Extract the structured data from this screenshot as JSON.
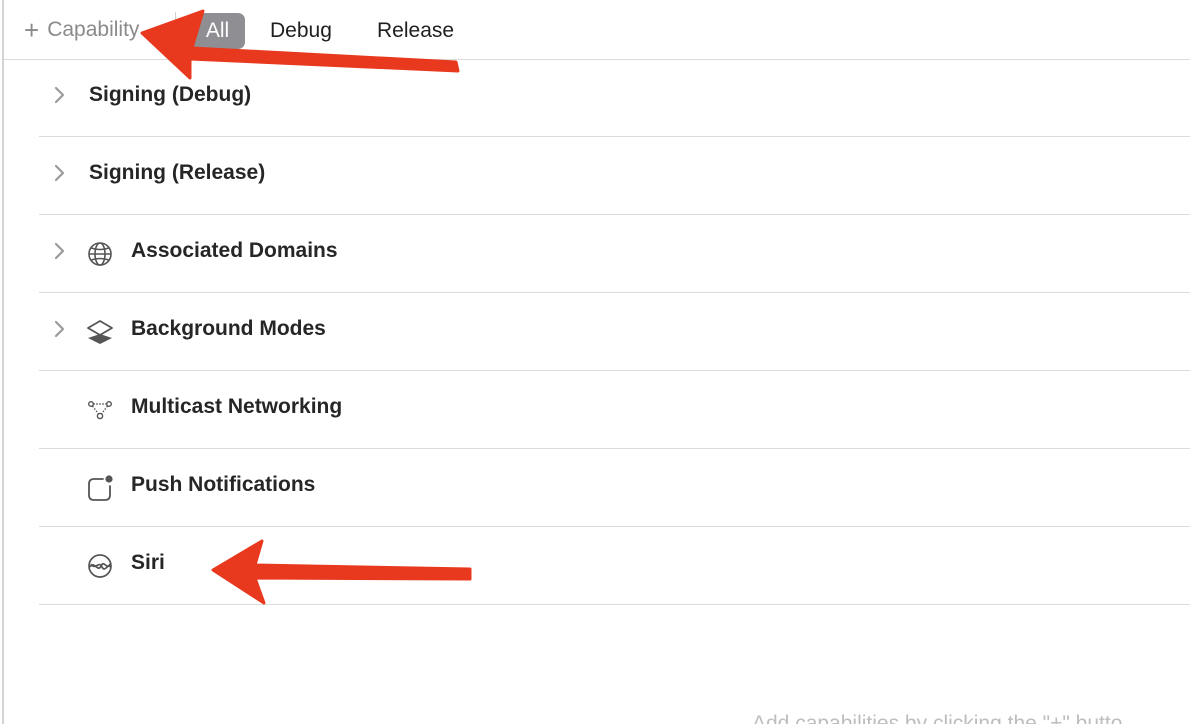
{
  "toolbar": {
    "add_label": "Capability",
    "add_icon": "plus-icon",
    "tabs": [
      {
        "label": "All",
        "selected": true
      },
      {
        "label": "Debug",
        "selected": false
      },
      {
        "label": "Release",
        "selected": false
      }
    ]
  },
  "capabilities": [
    {
      "label": "Signing (Debug)",
      "expandable": true,
      "icon": null
    },
    {
      "label": "Signing (Release)",
      "expandable": true,
      "icon": null
    },
    {
      "label": "Associated Domains",
      "expandable": true,
      "icon": "globe-icon"
    },
    {
      "label": "Background Modes",
      "expandable": true,
      "icon": "layers-icon"
    },
    {
      "label": "Multicast Networking",
      "expandable": false,
      "icon": "network-nodes-icon"
    },
    {
      "label": "Push Notifications",
      "expandable": false,
      "icon": "notification-badge-icon"
    },
    {
      "label": "Siri",
      "expandable": false,
      "icon": "siri-icon"
    }
  ],
  "annotations": {
    "arrow_color": "#e8391f"
  },
  "footer_hint": "Add capabilities by clicking the \"+\" butto"
}
